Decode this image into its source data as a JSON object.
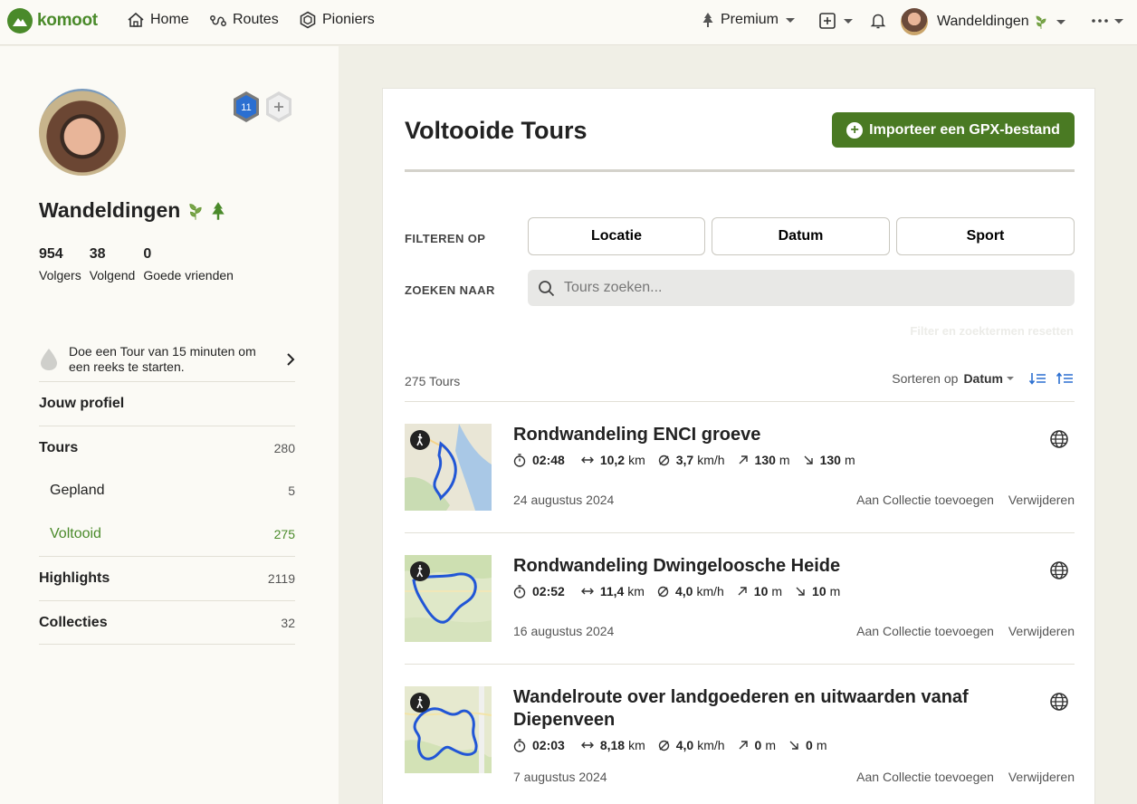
{
  "nav": {
    "logo": "komoot",
    "home": "Home",
    "routes": "Routes",
    "pioniers": "Pioniers",
    "premium": "Premium",
    "user": "Wandeldingen"
  },
  "profile": {
    "name": "Wandeldingen",
    "badge_level": "11",
    "stats": [
      {
        "num": "954",
        "label": "Volgers"
      },
      {
        "num": "38",
        "label": "Volgend"
      },
      {
        "num": "0",
        "label": "Goede vrienden"
      }
    ],
    "streak_text": "Doe een Tour van 15 minuten om een reeks te starten."
  },
  "menu": [
    {
      "label": "Jouw profiel",
      "count": ""
    },
    {
      "label": "Tours",
      "count": "280"
    },
    {
      "label": "Gepland",
      "count": "5"
    },
    {
      "label": "Voltooid",
      "count": "275"
    },
    {
      "label": "Highlights",
      "count": "2119"
    },
    {
      "label": "Collecties",
      "count": "32"
    }
  ],
  "main": {
    "title": "Voltooide Tours",
    "import_label": "Importeer een GPX-bestand",
    "filter_label": "FILTEREN OP",
    "filters": [
      "Locatie",
      "Datum",
      "Sport"
    ],
    "search_label": "ZOEKEN NAAR",
    "search_placeholder": "Tours zoeken...",
    "reset_label": "Filter en zoektermen resetten",
    "count": "275 Tours",
    "sort_label": "Sorteren op",
    "sort_value": "Datum"
  },
  "tours": [
    {
      "name": "Rondwandeling ENCI groeve",
      "duration": "02:48",
      "distance": "10,2",
      "speed": "3,7",
      "up": "130",
      "down": "130",
      "date": "24 augustus 2024"
    },
    {
      "name": "Rondwandeling Dwingeloosche Heide",
      "duration": "02:52",
      "distance": "11,4",
      "speed": "4,0",
      "up": "10",
      "down": "10",
      "date": "16 augustus 2024"
    },
    {
      "name": "Wandelroute over landgoederen en uitwaarden vanaf Diepenveen",
      "duration": "02:03",
      "distance": "8,18",
      "speed": "4,0",
      "up": "0",
      "down": "0",
      "date": "7 augustus 2024"
    }
  ],
  "units": {
    "km": "km",
    "speed": "km/h",
    "m": "m"
  },
  "tour_actions": {
    "collect": "Aan Collectie toevoegen",
    "delete": "Verwijderen"
  },
  "colors": {
    "brand": "#4a8a2a",
    "button": "#4a7a23",
    "route": "#2156d6"
  }
}
